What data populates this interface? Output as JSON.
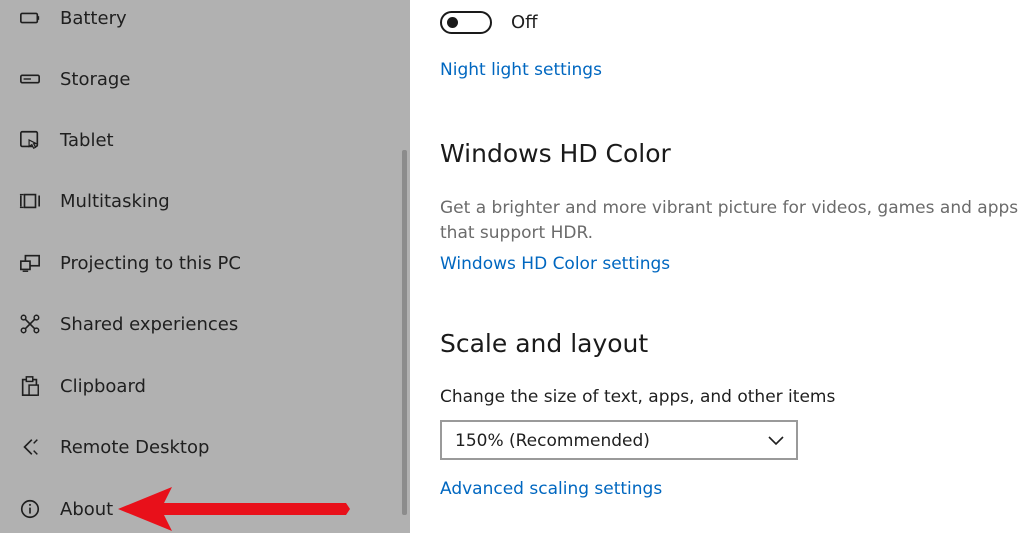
{
  "sidebar": {
    "items": [
      {
        "label": "Battery",
        "icon": "battery-icon"
      },
      {
        "label": "Storage",
        "icon": "storage-icon"
      },
      {
        "label": "Tablet",
        "icon": "tablet-icon"
      },
      {
        "label": "Multitasking",
        "icon": "multitasking-icon"
      },
      {
        "label": "Projecting to this PC",
        "icon": "projecting-icon"
      },
      {
        "label": "Shared experiences",
        "icon": "shared-experiences-icon"
      },
      {
        "label": "Clipboard",
        "icon": "clipboard-icon"
      },
      {
        "label": "Remote Desktop",
        "icon": "remote-desktop-icon"
      },
      {
        "label": "About",
        "icon": "info-icon"
      }
    ]
  },
  "main": {
    "night_light": {
      "toggle_state": "Off",
      "link": "Night light settings"
    },
    "hd_color": {
      "heading": "Windows HD Color",
      "description": "Get a brighter and more vibrant picture for videos, games and apps that support HDR.",
      "link": "Windows HD Color settings"
    },
    "scale_layout": {
      "heading": "Scale and layout",
      "field_label": "Change the size of text, apps, and other items",
      "dropdown_value": "150% (Recommended)",
      "link": "Advanced scaling settings"
    }
  },
  "colors": {
    "accent_link": "#0067c0",
    "annotation_arrow": "#e8101a",
    "sidebar_bg": "#b1b1b1"
  }
}
